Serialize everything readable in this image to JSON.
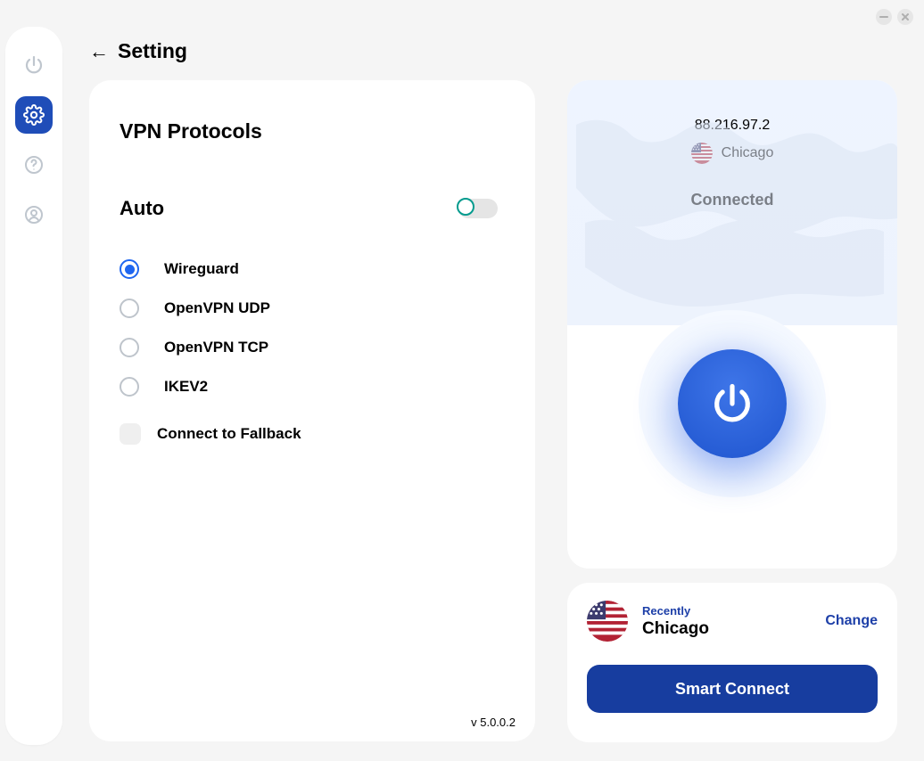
{
  "header": {
    "title": "Setting"
  },
  "sidebar": {
    "power": "power",
    "settings": "settings",
    "help": "help",
    "account": "account"
  },
  "settings": {
    "section_title": "VPN Protocols",
    "auto_label": "Auto",
    "protocols": [
      {
        "label": "Wireguard",
        "selected": true
      },
      {
        "label": "OpenVPN UDP",
        "selected": false
      },
      {
        "label": "OpenVPN TCP",
        "selected": false
      },
      {
        "label": "IKEV2",
        "selected": false
      }
    ],
    "fallback_label": "Connect to Fallback",
    "version": "v 5.0.0.2"
  },
  "status": {
    "ip": "88.216.97.2",
    "location": "Chicago",
    "state": "Connected",
    "flag_country": "US"
  },
  "recent": {
    "label": "Recently",
    "city": "Chicago",
    "change_label": "Change",
    "smart_connect_label": "Smart Connect",
    "flag_country": "US"
  }
}
